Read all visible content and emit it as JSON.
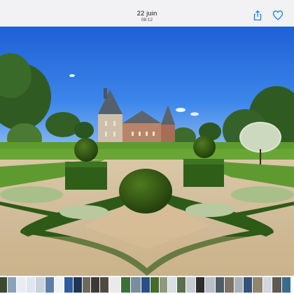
{
  "header": {
    "date": "22 juin",
    "time": "08:12",
    "share_icon": "share-icon",
    "favorite_icon": "heart-icon"
  },
  "photo": {
    "subject": "chateau-garden-photo"
  },
  "thumbnails": {
    "items": [
      {
        "color": "#3b4a2e"
      },
      {
        "color": "#8aa3b7"
      },
      {
        "color": "#e9edf2"
      },
      {
        "color": "#dfe6ee"
      },
      {
        "color": "#c9d3dd"
      },
      {
        "color": "#5b7fa6"
      },
      {
        "color": "#eef2f6"
      },
      {
        "color": "#2f5e9e"
      },
      {
        "color": "#1e3556"
      },
      {
        "color": "#6d6a5d"
      },
      {
        "color": "#3c3a35"
      },
      {
        "color": "#4f4a3f"
      },
      {
        "color": "#e8eaec"
      },
      {
        "color": "#3e6f3a"
      },
      {
        "color": "#7a8d9c"
      },
      {
        "color": "#2a4e8a"
      },
      {
        "color": "#466b2c"
      },
      {
        "color": "#8f9a7a"
      },
      {
        "color": "#d9dfe4"
      },
      {
        "color": "#5a6f4a"
      },
      {
        "color": "#c6ccd2"
      },
      {
        "color": "#2d2d2d"
      },
      {
        "color": "#b8c0c6"
      },
      {
        "color": "#4d5b66"
      },
      {
        "color": "#7d7365"
      },
      {
        "color": "#a9b2ba"
      },
      {
        "color": "#35527a"
      },
      {
        "color": "#90866f"
      },
      {
        "color": "#cfd6dc"
      },
      {
        "color": "#5e5a52"
      },
      {
        "color": "#3a6b8f"
      }
    ]
  }
}
